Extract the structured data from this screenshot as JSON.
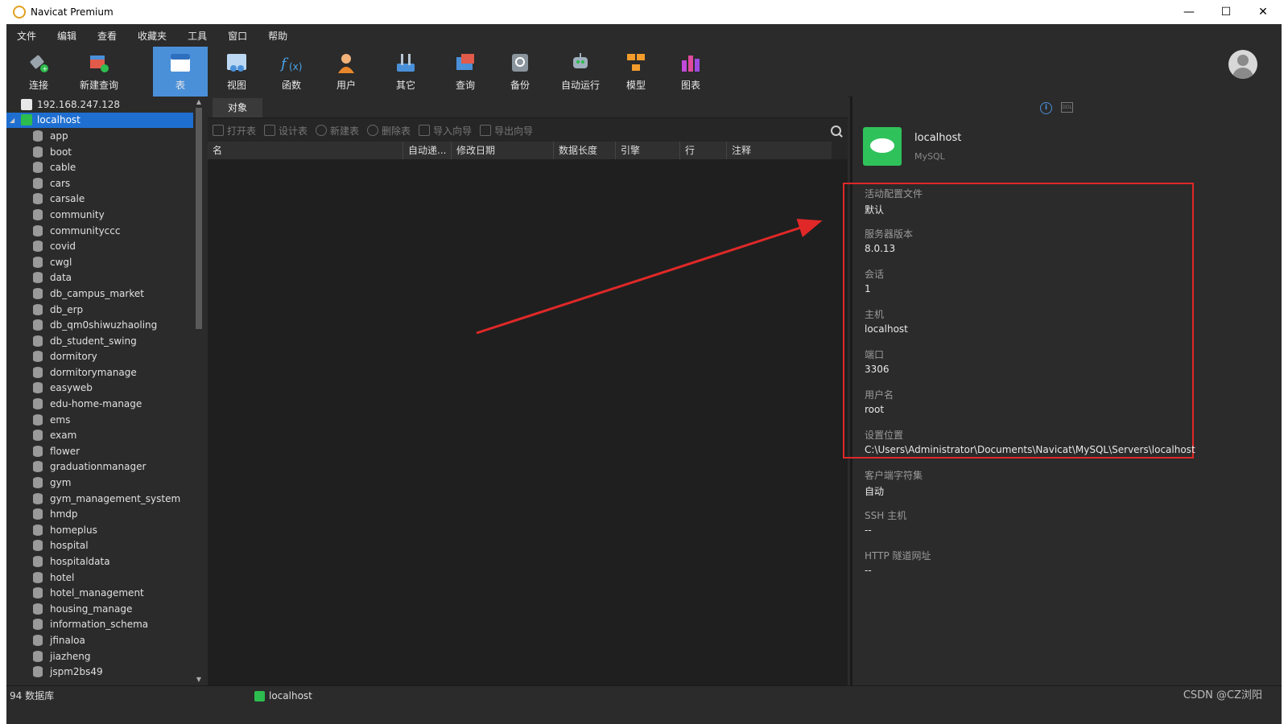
{
  "window": {
    "title": "Navicat Premium"
  },
  "menu": [
    "文件",
    "编辑",
    "查看",
    "收藏夹",
    "工具",
    "窗口",
    "帮助"
  ],
  "toolbar": [
    {
      "label": "连接",
      "icon": "plug-icon"
    },
    {
      "label": "新建查询",
      "icon": "new-query-icon"
    },
    {
      "label": "表",
      "icon": "table-icon"
    },
    {
      "label": "视图",
      "icon": "view-icon"
    },
    {
      "label": "函数",
      "icon": "function-icon"
    },
    {
      "label": "用户",
      "icon": "user-icon"
    },
    {
      "label": "其它",
      "icon": "tools-icon"
    },
    {
      "label": "查询",
      "icon": "query-icon"
    },
    {
      "label": "备份",
      "icon": "backup-icon"
    },
    {
      "label": "自动运行",
      "icon": "robot-icon"
    },
    {
      "label": "模型",
      "icon": "model-icon"
    },
    {
      "label": "图表",
      "icon": "chart-icon"
    }
  ],
  "sidebar": {
    "servers": [
      "192.168.247.128",
      "localhost"
    ],
    "databases": [
      "app",
      "boot",
      "cable",
      "cars",
      "carsale",
      "community",
      "communityccc",
      "covid",
      "cwgl",
      "data",
      "db_campus_market",
      "db_erp",
      "db_qm0shiwuzhaoling",
      "db_student_swing",
      "dormitory",
      "dormitorymanage",
      "easyweb",
      "edu-home-manage",
      "ems",
      "exam",
      "flower",
      "graduationmanager",
      "gym",
      "gym_management_system",
      "hmdp",
      "homeplus",
      "hospital",
      "hospitaldata",
      "hotel",
      "hotel_management",
      "housing_manage",
      "information_schema",
      "jfinaloa",
      "jiazheng",
      "jspm2bs49"
    ]
  },
  "center": {
    "tab": "对象",
    "actions": [
      "打开表",
      "设计表",
      "新建表",
      "删除表",
      "导入向导",
      "导出向导"
    ],
    "columns": [
      "名",
      "自动递...",
      "修改日期",
      "数据长度",
      "引擎",
      "行",
      "注释"
    ]
  },
  "info": {
    "name": "localhost",
    "type": "MySQL",
    "fields": [
      {
        "k": "活动配置文件",
        "v": "默认"
      },
      {
        "k": "服务器版本",
        "v": "8.0.13"
      },
      {
        "k": "会话",
        "v": "1"
      },
      {
        "k": "主机",
        "v": "localhost"
      },
      {
        "k": "端口",
        "v": "3306"
      },
      {
        "k": "用户名",
        "v": "root"
      },
      {
        "k": "设置位置",
        "v": "C:\\Users\\Administrator\\Documents\\Navicat\\MySQL\\Servers\\localhost"
      },
      {
        "k": "客户端字符集",
        "v": "自动"
      },
      {
        "k": "SSH 主机",
        "v": "--"
      },
      {
        "k": "HTTP 隧道网址",
        "v": "--"
      }
    ]
  },
  "status": {
    "count": "94 数据库",
    "current": "localhost",
    "watermark": "CSDN @CZ浏阳"
  },
  "colors": {
    "accent": "#4a90d9",
    "selection": "#1f6fd1",
    "highlight": "#e02828",
    "mysql": "#2fc25b"
  }
}
